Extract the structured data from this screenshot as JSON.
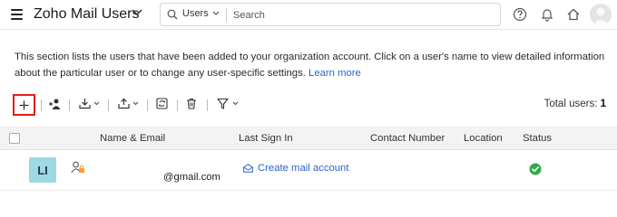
{
  "header": {
    "title": "Zoho Mail Users",
    "search_scope": "Users",
    "search_placeholder": "Search",
    "icons": [
      "menu-icon",
      "chevron-down-icon",
      "search-icon",
      "help-icon",
      "bell-icon",
      "home-icon",
      "user-avatar"
    ]
  },
  "description": {
    "text": "This section lists the users that have been added to your organization account. Click on a user's name to view detailed information about the particular user or to change any user-specific settings. ",
    "link": "Learn more"
  },
  "toolbar": {
    "tools": [
      "add-icon",
      "add-users-icon",
      "import-icon",
      "export-icon",
      "sync-icon",
      "delete-icon",
      "filter-icon"
    ],
    "total_label": "Total users: ",
    "total_value": "1"
  },
  "table": {
    "columns": [
      "Name & Email",
      "Last Sign In",
      "Contact Number",
      "Location",
      "Status"
    ],
    "rows": [
      {
        "initials": "LI",
        "email": "@gmail.com",
        "last_sign_in": "Create mail account",
        "contact_number": "",
        "location": "",
        "status": "active"
      }
    ]
  },
  "colors": {
    "accent_link": "#2a63c9",
    "highlight_border": "#e01e1e",
    "avatar_bg": "#9ed8e3",
    "status_ok": "#2eaa4a"
  }
}
